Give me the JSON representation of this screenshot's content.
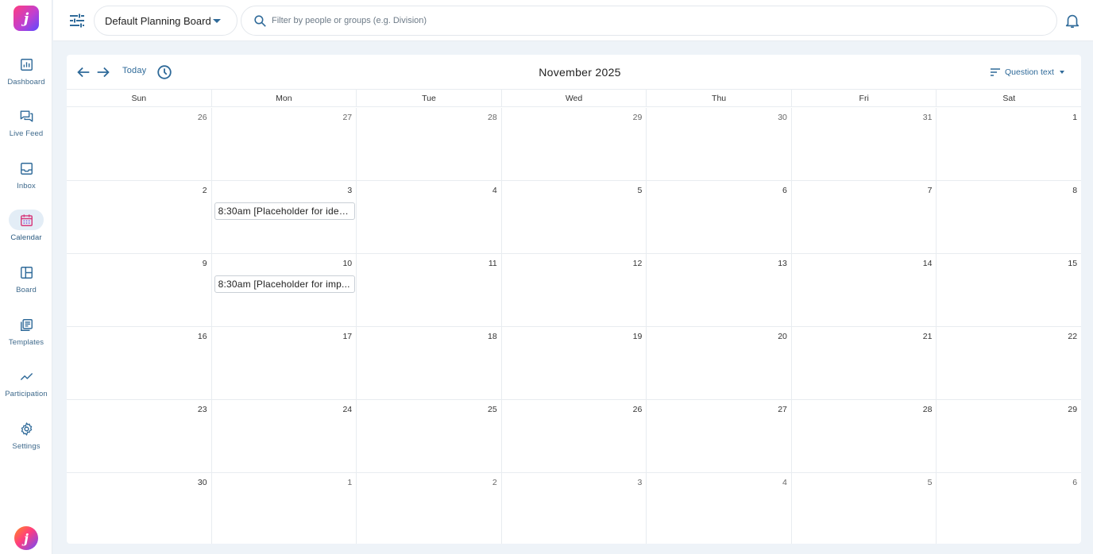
{
  "sidebar": {
    "logo_letter": "j",
    "items": [
      {
        "label": "Dashboard",
        "icon": "dashboard-icon"
      },
      {
        "label": "Live Feed",
        "icon": "chat-icon"
      },
      {
        "label": "Inbox",
        "icon": "inbox-icon"
      },
      {
        "label": "Calendar",
        "icon": "calendar-icon",
        "active": true
      },
      {
        "label": "Board",
        "icon": "board-icon"
      },
      {
        "label": "Templates",
        "icon": "templates-icon"
      },
      {
        "label": "Participation",
        "icon": "trend-icon"
      },
      {
        "label": "Settings",
        "icon": "gear-icon"
      }
    ]
  },
  "topbar": {
    "board_name": "Default Planning Board",
    "search_placeholder": "Filter by people or groups (e.g. Division)"
  },
  "calendar": {
    "today_label": "Today",
    "month_title": "November 2025",
    "sort_label": "Question text",
    "weekdays": [
      "Sun",
      "Mon",
      "Tue",
      "Wed",
      "Thu",
      "Fri",
      "Sat"
    ],
    "weeks": [
      [
        "26",
        "27",
        "28",
        "29",
        "30",
        "31",
        "1"
      ],
      [
        "2",
        "3",
        "4",
        "5",
        "6",
        "7",
        "8"
      ],
      [
        "9",
        "10",
        "11",
        "12",
        "13",
        "14",
        "15"
      ],
      [
        "16",
        "17",
        "18",
        "19",
        "20",
        "21",
        "22"
      ],
      [
        "23",
        "24",
        "25",
        "26",
        "27",
        "28",
        "29"
      ],
      [
        "30",
        "1",
        "2",
        "3",
        "4",
        "5",
        "6"
      ]
    ],
    "events": [
      {
        "week": 1,
        "day": 1,
        "text": "8:30am [Placeholder for idea..."
      },
      {
        "week": 2,
        "day": 1,
        "text": "8:30am [Placeholder for imp..."
      }
    ]
  },
  "colors": {
    "accent": "#2f6a99",
    "background": "#eef3f8"
  }
}
